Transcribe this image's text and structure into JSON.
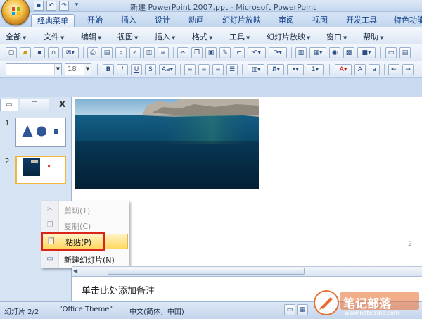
{
  "window": {
    "title": "新建 PowerPoint 2007.ppt - Microsoft PowerPoint"
  },
  "quick_access": [
    {
      "icon": "save-icon",
      "glyph": "▪"
    },
    {
      "icon": "undo-icon",
      "glyph": "↶"
    },
    {
      "icon": "redo-icon",
      "glyph": "↷"
    },
    {
      "icon": "customize-icon",
      "glyph": "▾"
    }
  ],
  "ribbon_tabs": [
    "经典菜单",
    "开始",
    "插入",
    "设计",
    "动画",
    "幻灯片放映",
    "审阅",
    "视图",
    "开发工具",
    "特色功能"
  ],
  "menus": [
    "全部",
    "文件",
    "编辑",
    "视图",
    "插入",
    "格式",
    "工具",
    "幻灯片放映",
    "窗口",
    "帮助"
  ],
  "toolbar": {
    "font_size": "18"
  },
  "pane": {
    "close": "X",
    "slide_numbers": [
      "1",
      "2"
    ]
  },
  "context_menu": {
    "items": [
      {
        "label": "剪切(T)",
        "icon": "scissors-icon",
        "glyph": "✂",
        "enabled": false
      },
      {
        "label": "复制(C)",
        "icon": "copy-icon",
        "glyph": "❐",
        "enabled": false
      },
      {
        "label": "粘贴(P)",
        "icon": "paste-icon",
        "glyph": "📋",
        "enabled": true
      },
      {
        "label": "新建幻灯片(N)",
        "icon": "new-slide-icon",
        "glyph": "▭",
        "enabled": true
      }
    ]
  },
  "slide": {
    "page_number": "2"
  },
  "notes": {
    "placeholder": "单击此处添加备注"
  },
  "status": {
    "slide_info": "幻灯片 2/2",
    "theme": "\"Office Theme\"",
    "language": "中文(简体，中国)"
  },
  "watermark": {
    "brand": "笔记部落",
    "url": "www.notetribe.com"
  },
  "colors": {
    "highlight": "#d9261c",
    "ribbon": "#c7d8ed",
    "paste_hover": "#ffd862"
  }
}
